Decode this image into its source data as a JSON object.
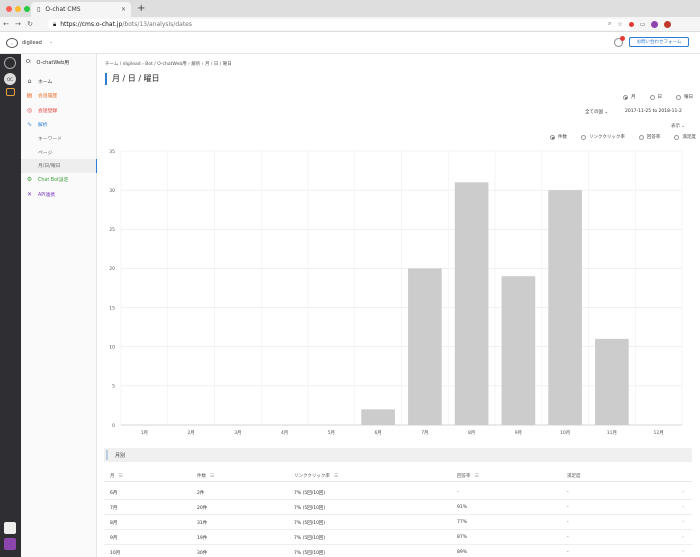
{
  "browser": {
    "tab_title": "O-chat CMS",
    "new_tab": "+",
    "url_host": "https://cms.o-chat.jp",
    "url_path": "/bots/13/analysis/dates",
    "traffic_colors": [
      "#fe5f57",
      "#febc2e",
      "#28c840"
    ]
  },
  "header": {
    "org_name": "digilead",
    "contact_button": "お問い合わせフォーム"
  },
  "sidebar": {
    "bot_prefix": "O:",
    "bot_name": "O-chatWeb用",
    "items": [
      {
        "label": "ホーム",
        "icon": "home-icon",
        "glyph": "⌂",
        "color": "#333333"
      },
      {
        "label": "会話履歴",
        "icon": "history-icon",
        "glyph": "▤",
        "color": "#e8712b"
      },
      {
        "label": "会話登録",
        "icon": "register-icon",
        "glyph": "◎",
        "color": "#e53935"
      },
      {
        "label": "解析",
        "icon": "analytics-icon",
        "glyph": "∿",
        "color": "#2e7dd7"
      }
    ],
    "sub_items": [
      "キーワード",
      "ページ",
      "月/日/曜日"
    ],
    "bottom_items": [
      {
        "label": "Chat Bot設定",
        "icon": "settings-icon",
        "glyph": "⚙",
        "color": "#3a9d3a"
      },
      {
        "label": "API連携",
        "icon": "api-icon",
        "glyph": "✕",
        "color": "#7b3fbf"
      }
    ]
  },
  "main": {
    "breadcrumb": "チーム / digilead  ›  Bot / O-chatWeb用  ›  解析  ›  月 / 日 / 曜日",
    "title": "月 / 日 / 曜日",
    "period_options": [
      "月",
      "日",
      "曜日"
    ],
    "period_selected": "月",
    "country_filter": "全ての国 ⌄",
    "date_range": "2017-11-25 to 2018-11-2",
    "display_link": "表示 ⌄",
    "metric_options": [
      "件数",
      "リンククリック率",
      "回答率",
      "満足度"
    ],
    "metric_selected": "件数"
  },
  "chart_data": {
    "type": "bar",
    "categories": [
      "1月",
      "2月",
      "3月",
      "4月",
      "5月",
      "6月",
      "7月",
      "8月",
      "9月",
      "10月",
      "11月",
      "12月"
    ],
    "values": [
      0,
      0,
      0,
      0,
      0,
      2,
      20,
      31,
      19,
      30,
      11,
      0
    ],
    "ylim": [
      0,
      35
    ],
    "yticks": [
      0,
      5,
      10,
      15,
      20,
      25,
      30,
      35
    ],
    "bar_color": "#cccccc",
    "grid": true
  },
  "table": {
    "section_title": "月別",
    "columns": [
      "月",
      "件数",
      "リンククリック率",
      "回答率",
      "満足度"
    ],
    "rows": [
      {
        "month": "6月",
        "count": "2件",
        "click": "7% (5回/10回)",
        "answer": "-",
        "satisfaction": "-"
      },
      {
        "month": "7月",
        "count": "20件",
        "click": "7% (5回/10回)",
        "answer": "91%",
        "satisfaction": "-"
      },
      {
        "month": "8月",
        "count": "31件",
        "click": "7% (5回/10回)",
        "answer": "77%",
        "satisfaction": "-"
      },
      {
        "month": "9月",
        "count": "19件",
        "click": "7% (5回/10回)",
        "answer": "87%",
        "satisfaction": "-"
      },
      {
        "month": "10月",
        "count": "30件",
        "click": "7% (5回/10回)",
        "answer": "89%",
        "satisfaction": "-"
      }
    ]
  }
}
